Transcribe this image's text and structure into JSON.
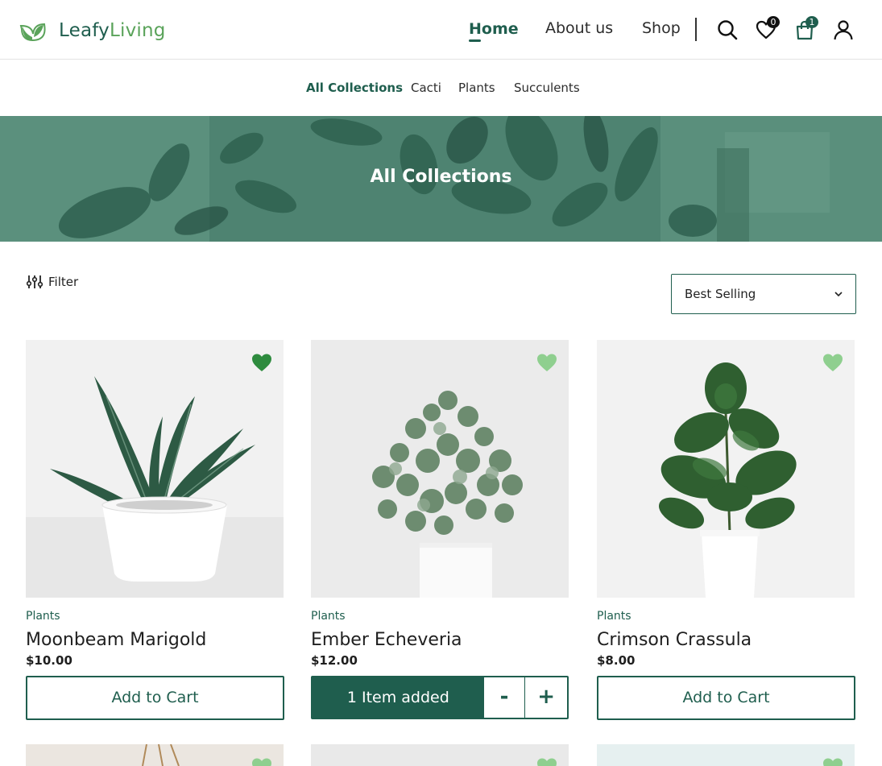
{
  "brand": {
    "part1": "Leafy",
    "part2": "Living"
  },
  "nav": {
    "home": "Home",
    "about": "About us",
    "shop": "Shop"
  },
  "header_icons": {
    "favorites_count": "0",
    "cart_count": "1"
  },
  "subnav": [
    "All Collections",
    "Cacti",
    "Plants",
    "Succulents"
  ],
  "hero": {
    "title": "All Collections"
  },
  "toolbar": {
    "filter_label": "Filter",
    "sort_selected": "Best Selling"
  },
  "products": [
    {
      "category": "Plants",
      "name": "Moonbeam Marigold",
      "price": "$10.00",
      "button": "Add to Cart",
      "favorited": true
    },
    {
      "category": "Plants",
      "name": "Ember Echeveria",
      "price": "$12.00",
      "added_label": "1 Item added",
      "minus": "-",
      "plus": "+",
      "favorited": false
    },
    {
      "category": "Plants",
      "name": "Crimson Crassula",
      "price": "$8.00",
      "button": "Add to Cart",
      "favorited": false
    }
  ],
  "colors": {
    "brand_dark": "#1f5e4e",
    "brand_light": "#5aa35a",
    "heart_active": "#2e8b3e",
    "heart_inactive": "#8fcf8f"
  }
}
